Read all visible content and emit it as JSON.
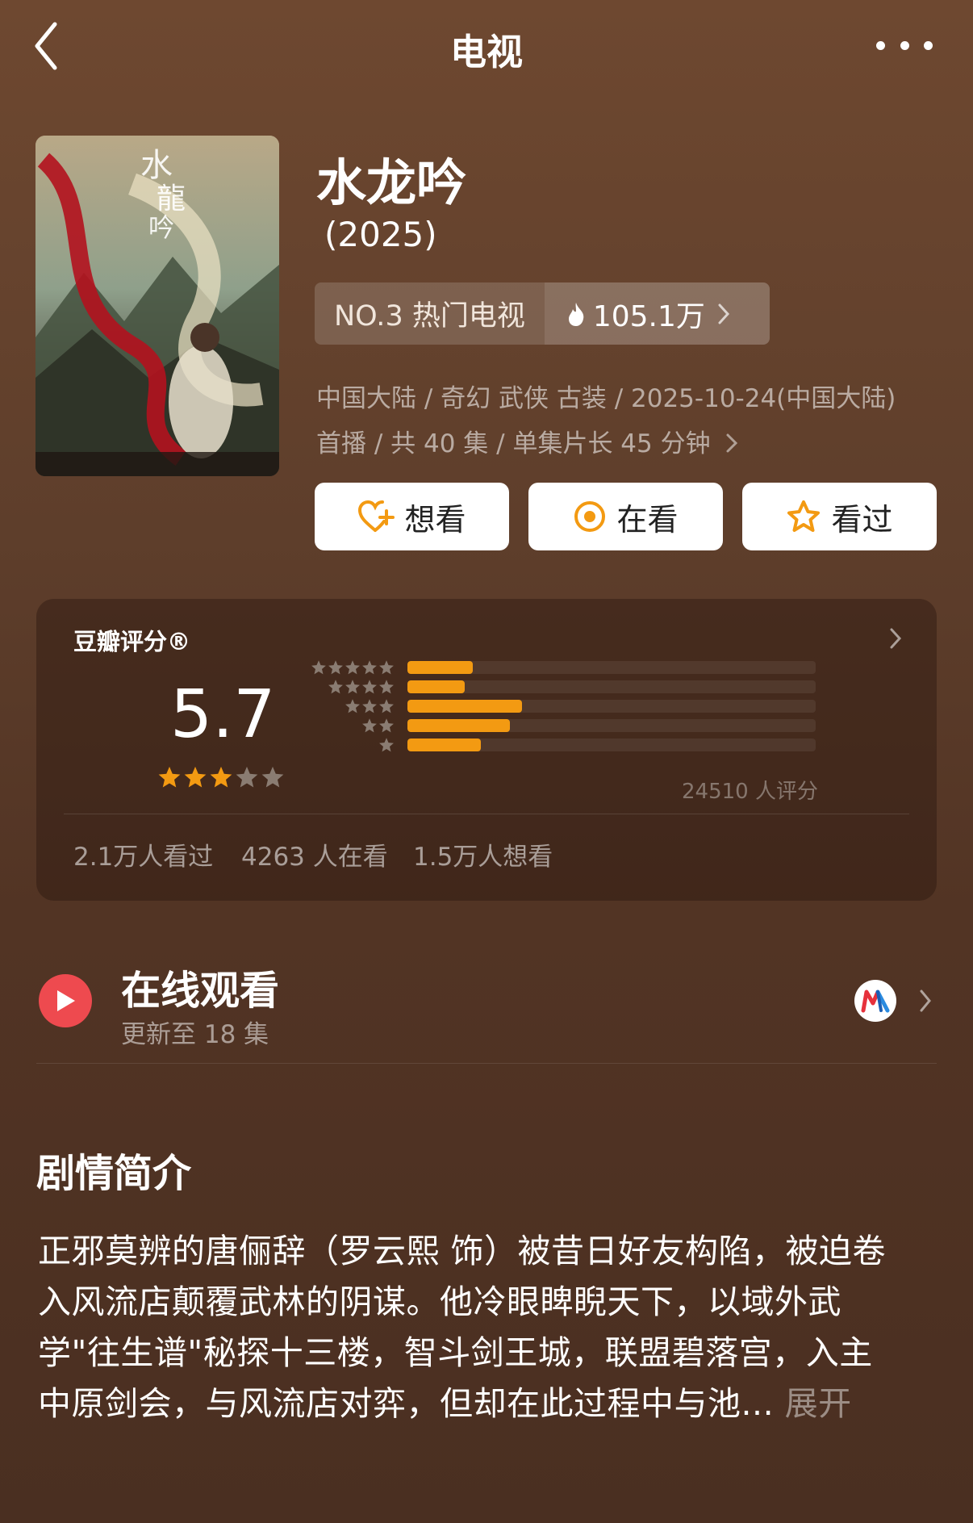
{
  "header": {
    "title": "电视",
    "back_icon": "chevron-left-icon",
    "more_icon": "more-dots-icon"
  },
  "show": {
    "title": "水龙吟",
    "year": "(2025)",
    "rank_label": "NO.3 热门电视",
    "heat_value": "105.1万",
    "meta_line1": "中国大陆 / 奇幻 武侠 古装 / 2025-10-24(中国大陆)",
    "meta_line2": "首播 / 共 40 集 / 单集片长 45 分钟"
  },
  "actions": [
    {
      "label": "想看",
      "icon": "heart-plus-icon"
    },
    {
      "label": "在看",
      "icon": "target-circle-icon"
    },
    {
      "label": "看过",
      "icon": "star-outline-icon"
    }
  ],
  "rating": {
    "label": "豆瓣评分®",
    "score": "5.7",
    "stars_filled": 3,
    "stars_total": 5,
    "distribution": [
      {
        "stars": 5,
        "fraction": 0.16
      },
      {
        "stars": 4,
        "fraction": 0.14
      },
      {
        "stars": 3,
        "fraction": 0.28
      },
      {
        "stars": 2,
        "fraction": 0.25
      },
      {
        "stars": 1,
        "fraction": 0.18
      }
    ],
    "count_text": "24510 人评分",
    "stats": [
      "2.1万人看过",
      "4263 人在看",
      "1.5万人想看"
    ]
  },
  "online": {
    "title": "在线观看",
    "subtitle": "更新至 18 集",
    "platform_icon": "mgtv-logo-icon"
  },
  "synopsis": {
    "heading": "剧情简介",
    "lines": [
      "正邪莫辨的唐俪辞（罗云熙 饰）被昔日好友构陷，被迫卷",
      "入风流店颠覆武林的阴谋。他冷眼睥睨天下，以域外武",
      "学\"往生谱\"秘探十三楼，智斗剑王城，联盟碧落宫，入主",
      "中原剑会，与风流店对弈，但却在此过程中与池..."
    ],
    "expand_label": "展开"
  },
  "colors": {
    "accent_orange": "#f39a12",
    "play_red": "#ee4a4f",
    "star_gray": "#8a7c72"
  }
}
